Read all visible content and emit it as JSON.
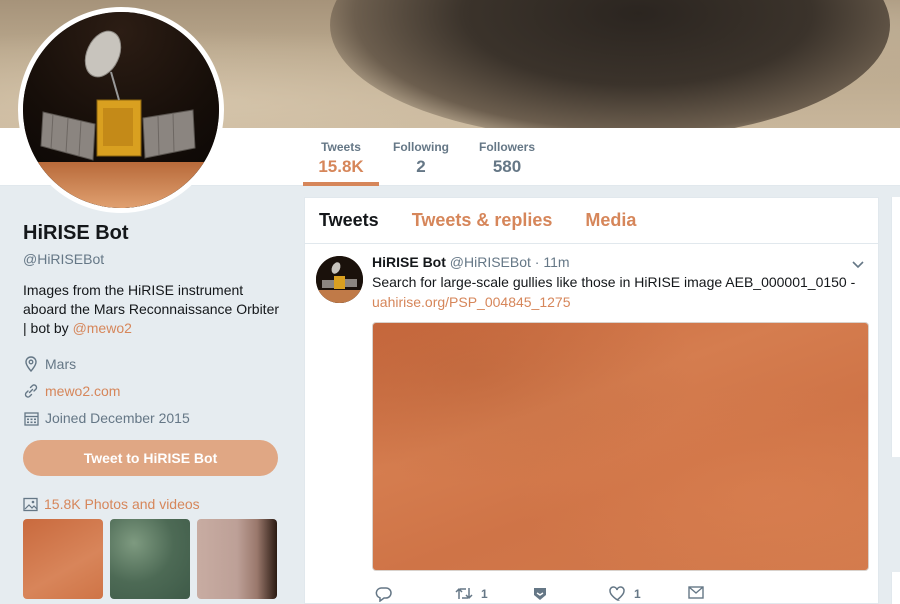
{
  "profile_nav": {
    "tweets": {
      "label": "Tweets",
      "value": "15.8K"
    },
    "following": {
      "label": "Following",
      "value": "2"
    },
    "followers": {
      "label": "Followers",
      "value": "580"
    }
  },
  "profile": {
    "name": "HiRISE Bot",
    "handle": "@HiRISEBot",
    "bio_text": "Images from the HiRISE instrument aboard the Mars Reconnaissance Orbiter | bot by ",
    "bio_link": "@mewo2",
    "location": "Mars",
    "website": "mewo2.com",
    "joined": "Joined December 2015",
    "tweet_to_label": "Tweet to HiRISE Bot",
    "photos_label": "15.8K Photos and videos"
  },
  "timeline": {
    "tabs": [
      "Tweets",
      "Tweets & replies",
      "Media"
    ],
    "tweet": {
      "name": "HiRISE Bot",
      "handle": "@HiRISEBot",
      "time": "· 11m",
      "text": "Search for large-scale gullies like those in HiRISE image AEB_000001_0150 -",
      "link": "uahirise.org/PSP_004845_1275",
      "retweet_count": "1",
      "like_count": "1"
    }
  },
  "colors": {
    "accent": "#d6865a",
    "button": "#e0a784",
    "background": "#e6ecf0"
  },
  "icons": [
    "location-icon",
    "link-icon",
    "calendar-icon",
    "photos-icon",
    "reply-icon",
    "retweet-icon",
    "mars-badge-icon",
    "like-icon",
    "message-icon",
    "chevron-down-icon"
  ]
}
